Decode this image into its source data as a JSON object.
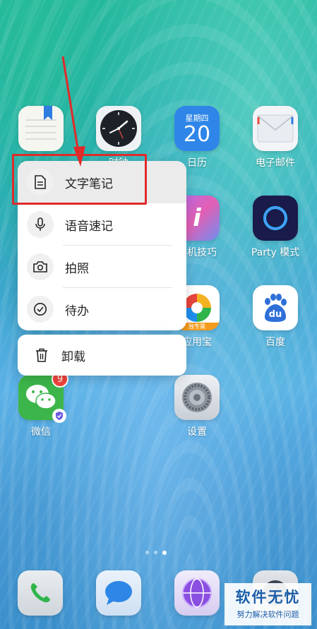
{
  "apps": {
    "notes": {
      "label": ""
    },
    "clock": {
      "label": "时钟"
    },
    "calendar": {
      "label": "日历",
      "weekday": "星期四",
      "day": "20"
    },
    "email": {
      "label": "电子邮件"
    },
    "tips": {
      "label": "手机技巧"
    },
    "party": {
      "label": "Party 模式"
    },
    "appstore": {
      "label": "应用宝",
      "tag": "独专属"
    },
    "baidu": {
      "label": "百度",
      "logo_text": "du"
    },
    "wechat": {
      "label": "微信",
      "badge": "9"
    },
    "settings": {
      "label": "设置"
    }
  },
  "context_menu": {
    "items": [
      {
        "label": "文字笔记",
        "icon": "document-icon"
      },
      {
        "label": "语音速记",
        "icon": "microphone-icon"
      },
      {
        "label": "拍照",
        "icon": "camera-icon"
      },
      {
        "label": "待办",
        "icon": "check-circle-icon"
      }
    ],
    "uninstall": {
      "label": "卸载",
      "icon": "trash-icon"
    }
  },
  "dock": [
    "phone-icon",
    "messages-icon",
    "browser-icon",
    "camera-icon"
  ],
  "watermark": {
    "title": "软件无忧",
    "subtitle": "努力解决软件问题"
  },
  "colors": {
    "highlight": "#e02a2a",
    "party_ring": "#1fc6ff",
    "calendar_bg": "#2f86e8"
  }
}
